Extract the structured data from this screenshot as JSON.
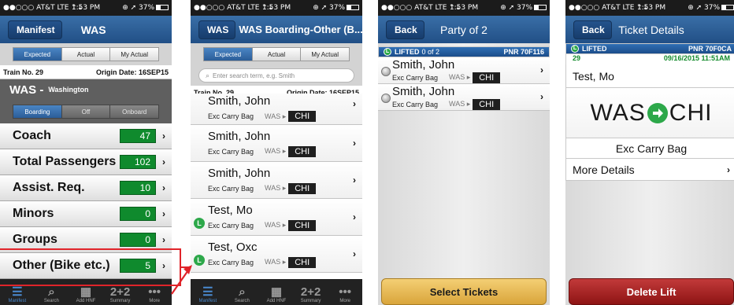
{
  "status": {
    "carrier": "●●○○○ AT&T  LTE  ⇡⇣",
    "time": "1:53 PM",
    "right": "⊕ ➚ 37%"
  },
  "s1": {
    "title": "Manifest",
    "subtitle": "WAS",
    "tabs": [
      "Expected",
      "Actual",
      "My Actual"
    ],
    "train": "Train No. 29",
    "origin": "Origin Date: 16SEP15",
    "station_code": "WAS -",
    "station_name": "Washington",
    "modes": [
      "Boarding",
      "Off",
      "Onboard"
    ],
    "rows": [
      {
        "label": "Coach",
        "value": "47"
      },
      {
        "label": "Total Passengers",
        "value": "102"
      },
      {
        "label": "Assist. Req.",
        "value": "10"
      },
      {
        "label": "Minors",
        "value": "0"
      },
      {
        "label": "Groups",
        "value": "0"
      },
      {
        "label": "Other (Bike etc.)",
        "value": "5"
      }
    ]
  },
  "tabbar": [
    {
      "label": "Manifest",
      "icon": "☰"
    },
    {
      "label": "Search",
      "icon": "⌕"
    },
    {
      "label": "Add HNF",
      "icon": "▦"
    },
    {
      "label": "Summary",
      "icon": "2+2"
    },
    {
      "label": "More",
      "icon": "•••"
    }
  ],
  "s2": {
    "title": "WAS Boarding-Other (B...",
    "tabs": [
      "Expected",
      "Actual",
      "My Actual"
    ],
    "search_placeholder": "Enter search term, e.g. Smith",
    "train": "Train No. 29",
    "origin": "Origin Date: 16SEP15",
    "pax": [
      {
        "name": "Smith, John",
        "desc": "Exc Carry Bag",
        "from": "WAS ▸",
        "to": "CHI"
      },
      {
        "name": "Smith, John",
        "desc": "Exc Carry Bag",
        "from": "WAS ▸",
        "to": "CHI"
      },
      {
        "name": "Smith, John",
        "desc": "Exc Carry Bag",
        "from": "WAS ▸",
        "to": "CHI"
      },
      {
        "name": "Test, Mo",
        "desc": "Exc Carry Bag",
        "from": "WAS ▸",
        "to": "CHI"
      },
      {
        "name": "Test, Oxc",
        "desc": "Exc Carry Bag",
        "from": "WAS ▸",
        "to": "CHI"
      }
    ],
    "dot_letter": "L"
  },
  "s3": {
    "back": "Back",
    "title": "Party of 2",
    "lifted_label": "LIFTED",
    "lifted_count": "0 of 2",
    "pnr": "PNR 70F116",
    "pax": [
      {
        "name": "Smith, John",
        "desc": "Exc Carry Bag",
        "from": "WAS ▸",
        "to": "CHI"
      },
      {
        "name": "Smith, John",
        "desc": "Exc Carry Bag",
        "from": "WAS ▸",
        "to": "CHI"
      }
    ],
    "button": "Select Tickets"
  },
  "s4": {
    "back": "Back",
    "title": "Ticket Details",
    "lifted_label": "LIFTED",
    "pnr": "PNR 70F0CA",
    "car": "29",
    "datetime": "09/16/2015 11:51AM",
    "name": "Test, Mo",
    "from": "WAS",
    "to": "CHI",
    "desc": "Exc Carry Bag",
    "more": "More Details",
    "button": "Delete Lift"
  },
  "colors": {
    "nav": "#2b5d98",
    "green": "#0f8a2d",
    "callout": "#e0242a",
    "gold": "#e4b955",
    "red": "#a52222"
  }
}
